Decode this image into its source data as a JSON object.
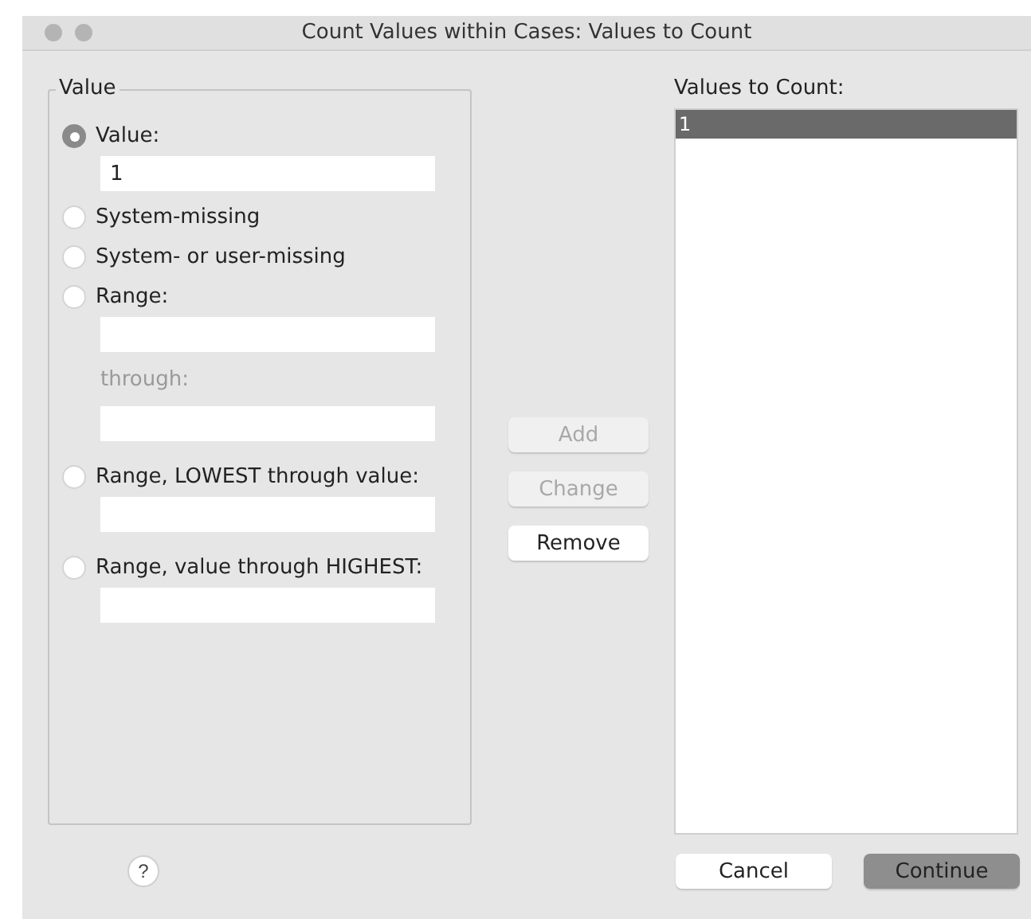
{
  "window": {
    "title": "Count Values within Cases: Values to Count"
  },
  "value_group": {
    "title": "Value",
    "items": [
      {
        "kind": "radio",
        "label": "Value:",
        "selected": true
      },
      {
        "kind": "field",
        "value": "1"
      },
      {
        "kind": "radio",
        "label": "System-missing",
        "selected": false
      },
      {
        "kind": "radio",
        "label": "System- or user-missing",
        "selected": false
      },
      {
        "kind": "radio",
        "label": "Range:",
        "selected": false
      },
      {
        "kind": "field",
        "value": ""
      },
      {
        "kind": "label",
        "text": "through:",
        "disabled": true
      },
      {
        "kind": "field",
        "value": ""
      },
      {
        "kind": "radio",
        "label": "Range, LOWEST through value:",
        "selected": false
      },
      {
        "kind": "field",
        "value": ""
      },
      {
        "kind": "radio",
        "label": "Range, value through HIGHEST:",
        "selected": false
      },
      {
        "kind": "field",
        "value": ""
      }
    ]
  },
  "list_buttons": [
    {
      "label": "Add",
      "disabled": true
    },
    {
      "label": "Change",
      "disabled": true
    },
    {
      "label": "Remove",
      "disabled": false
    }
  ],
  "values_to_count": {
    "label": "Values to Count:",
    "items": [
      {
        "text": "1",
        "selected": true
      }
    ]
  },
  "footer": {
    "help": "?",
    "buttons": [
      {
        "label": "Cancel",
        "default": false
      },
      {
        "label": "Continue",
        "default": true
      }
    ]
  }
}
